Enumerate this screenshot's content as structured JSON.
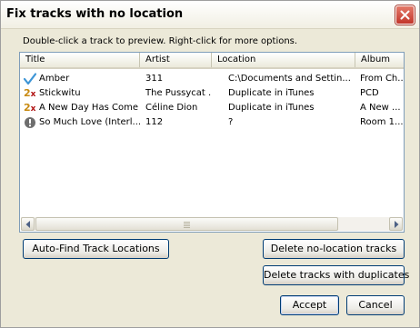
{
  "window": {
    "title": "Fix tracks with no location"
  },
  "hint_text": "Double-click a track to preview.  Right-click for more options.",
  "columns": [
    "Title",
    "Artist",
    "Location",
    "Album"
  ],
  "rows": [
    {
      "status_icon": "checkmark-icon",
      "title": "Amber",
      "artist": "311",
      "location": "C:\\Documents and Settin...",
      "album": "From Ch..."
    },
    {
      "status_icon": "duplicate-2x-icon",
      "title": "Stickwitu",
      "artist": "The Pussycat ...",
      "location": "Duplicate in iTunes",
      "album": "PCD"
    },
    {
      "status_icon": "duplicate-2x-icon",
      "title": "A New Day Has Come",
      "artist": "Céline Dion",
      "location": "Duplicate in iTunes",
      "album": "A New ..."
    },
    {
      "status_icon": "unknown-status-icon",
      "title": "So Much Love (Interl...",
      "artist": "112",
      "location": "?",
      "album": "Room 1..."
    }
  ],
  "duplicate_icon_glyph": {
    "num": "2",
    "x": "x"
  },
  "buttons": {
    "auto_find": "Auto-Find Track Locations",
    "delete_no_location": "Delete no-location tracks",
    "delete_duplicates": "Delete tracks with duplicates",
    "accept": "Accept",
    "cancel": "Cancel"
  },
  "colors": {
    "titlebar_close": "#c2352a",
    "check": "#3d95d6",
    "dup_number": "#c88a10",
    "dup_x": "#b01010",
    "unknown": "#6e6e6e",
    "button_border": "#003c74"
  }
}
